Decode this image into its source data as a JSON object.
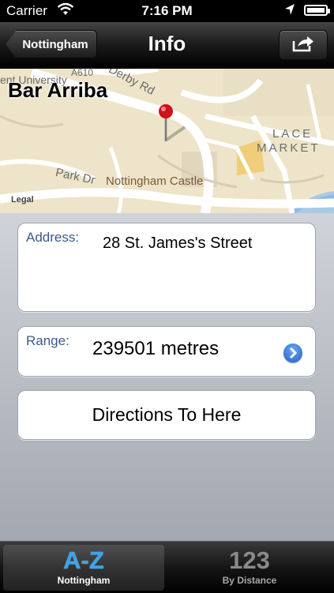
{
  "status_bar": {
    "carrier": "Carrier",
    "time": "7:16 PM"
  },
  "nav": {
    "back_label": "Nottingham",
    "title": "Info"
  },
  "map": {
    "place_name": "Bar Arriba",
    "labels": {
      "university": "ent University",
      "road_a610": "A610",
      "derby_rd": "Derby Rd",
      "lace_market_1": "LACE",
      "lace_market_2": "MARKET",
      "park_dr": "Park Dr",
      "castle": "Nottingham Castle"
    },
    "legal": "Legal"
  },
  "address": {
    "label": "Address:",
    "value": "28 St. James's Street"
  },
  "range": {
    "label": "Range:",
    "value": "239501 metres"
  },
  "directions": {
    "label": "Directions To Here"
  },
  "tabs": [
    {
      "glyph": "A-Z",
      "label": "Nottingham",
      "selected": true
    },
    {
      "glyph": "123",
      "label": "By Distance",
      "selected": false
    }
  ],
  "colors": {
    "accent_blue": "#39a4f0",
    "field_label_blue": "#3a5b8c",
    "map_background": "#ede4c9"
  }
}
